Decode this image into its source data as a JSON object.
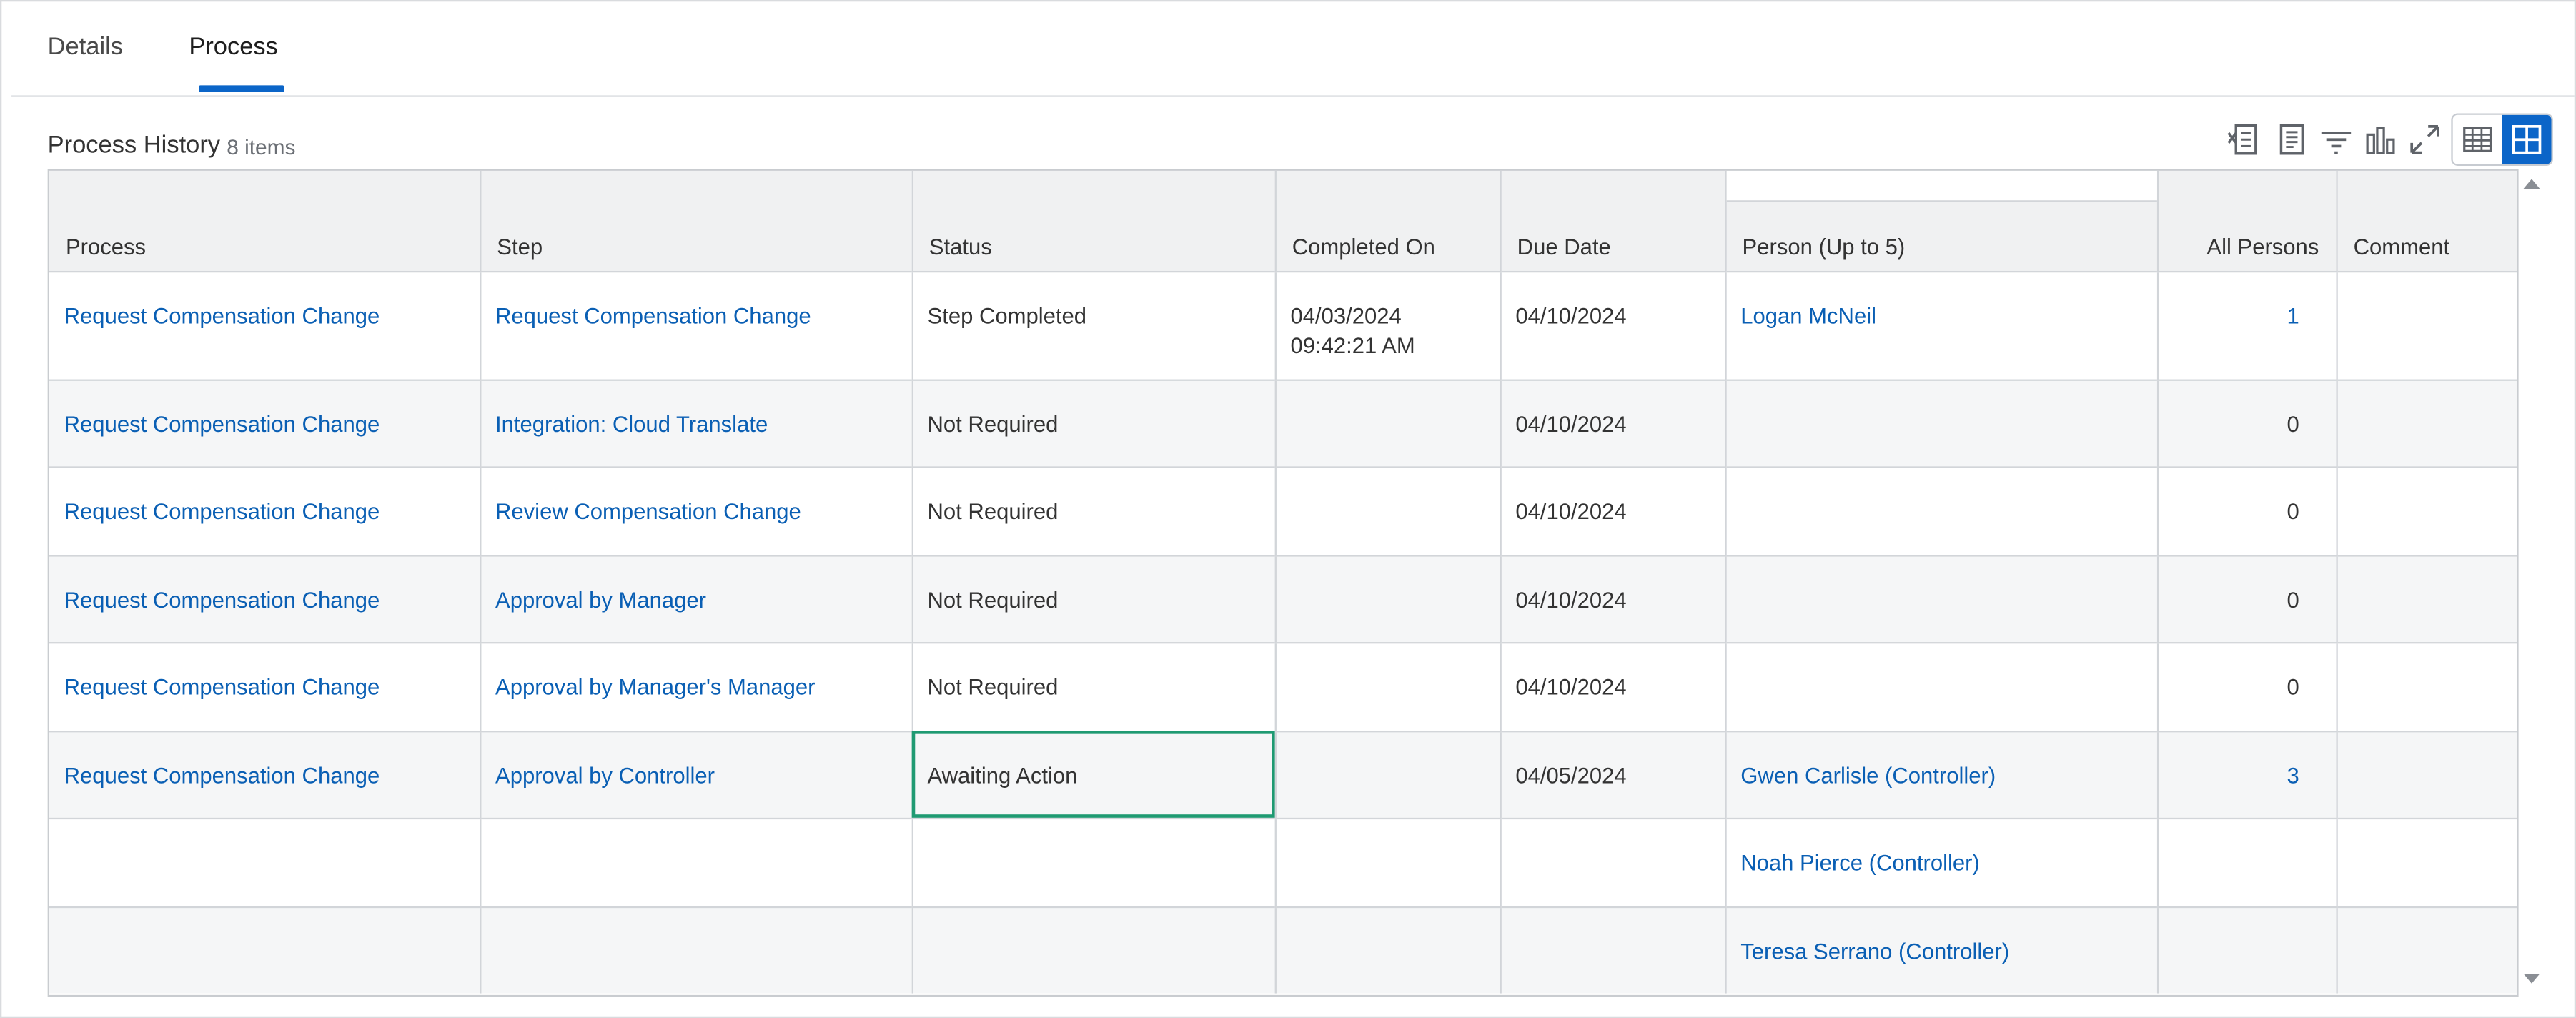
{
  "tabs": [
    {
      "label": "Details"
    },
    {
      "label": "Process"
    }
  ],
  "section": {
    "title": "Process History",
    "count": "8 items"
  },
  "toolbar": {
    "icons": [
      "export-excel-icon",
      "print-icon",
      "filter-icon",
      "chart-icon",
      "fullscreen-icon"
    ],
    "view_toggle": [
      "table-view-icon",
      "grid-view-icon"
    ],
    "active_view": "grid-view-icon",
    "accent": "#0b65c8"
  },
  "columns": [
    "Process",
    "Step",
    "Status",
    "Completed On",
    "Due Date",
    "Person (Up to 5)",
    "All Persons",
    "Comment"
  ],
  "rows": [
    {
      "process": "Request Compensation Change",
      "step": "Request Compensation Change",
      "status": "Step Completed",
      "completed_date": "04/03/2024",
      "completed_time": "09:42:21 AM",
      "due": "04/10/2024",
      "person": "Logan McNeil",
      "all_persons": "1",
      "comment": ""
    },
    {
      "process": "Request Compensation Change",
      "step": "Integration: Cloud Translate",
      "status": "Not Required",
      "completed_date": "",
      "completed_time": "",
      "due": "04/10/2024",
      "person": "",
      "all_persons": "0",
      "comment": ""
    },
    {
      "process": "Request Compensation Change",
      "step": "Review Compensation Change",
      "status": "Not Required",
      "completed_date": "",
      "completed_time": "",
      "due": "04/10/2024",
      "person": "",
      "all_persons": "0",
      "comment": ""
    },
    {
      "process": "Request Compensation Change",
      "step": "Approval by Manager",
      "status": "Not Required",
      "completed_date": "",
      "completed_time": "",
      "due": "04/10/2024",
      "person": "",
      "all_persons": "0",
      "comment": ""
    },
    {
      "process": "Request Compensation Change",
      "step": "Approval by Manager's Manager",
      "status": "Not Required",
      "completed_date": "",
      "completed_time": "",
      "due": "04/10/2024",
      "person": "",
      "all_persons": "0",
      "comment": ""
    },
    {
      "process": "Request Compensation Change",
      "step": "Approval by Controller",
      "status": "Awaiting Action",
      "completed_date": "",
      "completed_time": "",
      "due": "04/05/2024",
      "person": "Gwen Carlisle (Controller)",
      "all_persons": "3",
      "comment": ""
    },
    {
      "process": "",
      "step": "",
      "status": "",
      "completed_date": "",
      "completed_time": "",
      "due": "",
      "person": "Noah Pierce (Controller)",
      "all_persons": "",
      "comment": ""
    },
    {
      "process": "",
      "step": "",
      "status": "",
      "completed_date": "",
      "completed_time": "",
      "due": "",
      "person": "Teresa Serrano (Controller)",
      "all_persons": "",
      "comment": ""
    }
  ],
  "selected_cell": {
    "row": 5,
    "column": "Status"
  },
  "colors": {
    "link": "#0a5fb4",
    "selection": "#1f9a72",
    "header_bg": "#f0f1f2"
  }
}
